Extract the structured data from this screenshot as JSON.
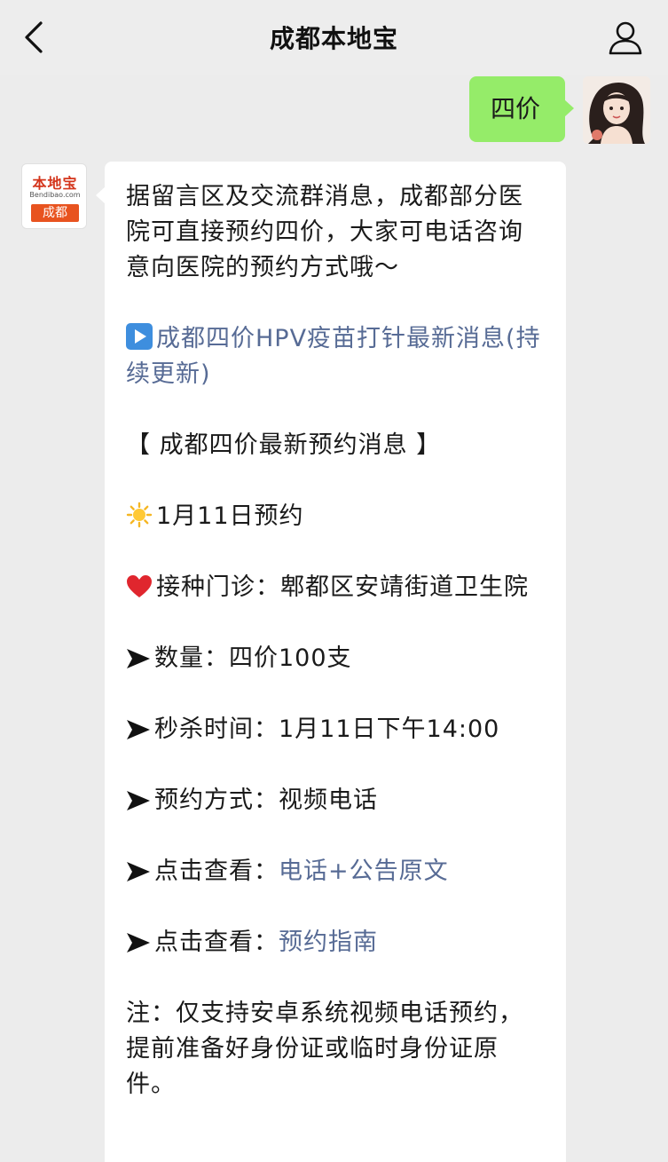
{
  "header": {
    "title": "成都本地宝"
  },
  "outgoing_message": {
    "text": "四价"
  },
  "brand_avatar": {
    "top": "本地宝",
    "site": "Bendibao.com",
    "city": "成都"
  },
  "message": {
    "intro": "据留言区及交流群消息，成都部分医院可直接预约四价，大家可电话咨询意向医院的预约方式哦～",
    "article_link": "成都四价HPV疫苗打针最新消息(持续更新)",
    "section_title": "【 成都四价最新预约消息 】",
    "date_line": "1月11日预约",
    "clinic_line": "接种门诊：郫都区安靖街道卫生院",
    "quantity_line": "数量：四价100支",
    "seckill_line": "秒杀时间：1月11日下午14:00",
    "method_line": "预约方式：视频电话",
    "view1_label": "点击查看：",
    "view1_link": "电话+公告原文",
    "view2_label": "点击查看：",
    "view2_link": "预约指南",
    "note": "注：仅支持安卓系统视频电话预约，提前准备好身份证或临时身份证原件。"
  },
  "icons": {
    "back": "chevron-left-icon",
    "profile": "person-icon",
    "play": "play-icon",
    "sun": "sun-icon",
    "heart": "heart-icon",
    "arrow": "arrow-right-icon"
  }
}
